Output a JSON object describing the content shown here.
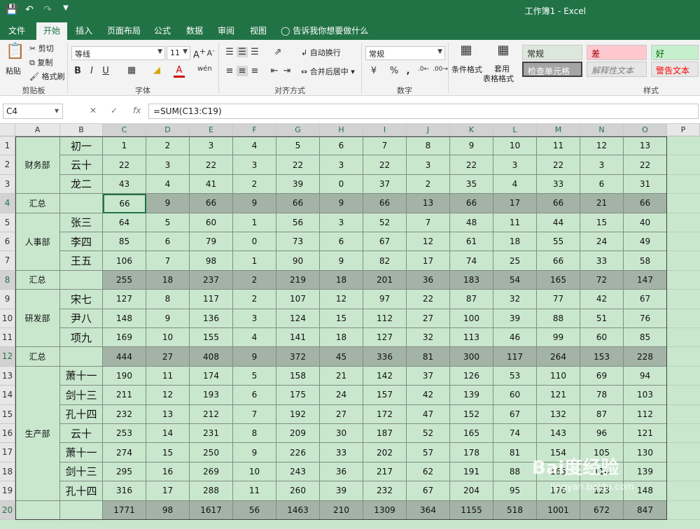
{
  "title_bar": {
    "title": "工作簿1 - Excel",
    "qat": [
      "save-icon",
      "undo-icon",
      "redo-icon",
      "customize-icon"
    ]
  },
  "tabs": [
    "文件",
    "开始",
    "插入",
    "页面布局",
    "公式",
    "数据",
    "审阅",
    "视图"
  ],
  "active_tab": "开始",
  "tell_me": "告诉我你想要做什么",
  "ribbon": {
    "clipboard": {
      "label": "剪贴板",
      "paste": "粘贴",
      "cut": "剪切",
      "copy": "复制",
      "format_painter": "格式刷"
    },
    "font": {
      "label": "字体",
      "name": "等线",
      "size": "11",
      "bold": "B",
      "italic": "I",
      "underline": "U"
    },
    "alignment": {
      "label": "对齐方式",
      "wrap": "自动换行",
      "merge": "合并后居中"
    },
    "number": {
      "label": "数字",
      "format": "常规",
      "percent": "%",
      "comma": ","
    },
    "styles_group": {
      "label": "样式",
      "cond_format": "条件格式",
      "table_format_1": "套用",
      "table_format_2": "表格格式",
      "normal": "常规",
      "bad": "差",
      "good": "好",
      "check": "检查单元格",
      "explanatory": "解释性文本",
      "warning": "警告文本"
    }
  },
  "formula_bar": {
    "name_box": "C4",
    "fx": "fx",
    "formula": "=SUM(C13:C19)"
  },
  "columns": [
    "A",
    "B",
    "C",
    "D",
    "E",
    "F",
    "G",
    "H",
    "I",
    "J",
    "K",
    "L",
    "M",
    "N",
    "O",
    "P"
  ],
  "rows": [
    {
      "n": "1",
      "dept": "财务部",
      "name": "初一",
      "vals": [
        "1",
        "2",
        "3",
        "4",
        "5",
        "6",
        "7",
        "8",
        "9",
        "10",
        "11",
        "12",
        "13"
      ]
    },
    {
      "n": "2",
      "dept": "",
      "name": "云十",
      "vals": [
        "22",
        "3",
        "22",
        "3",
        "22",
        "3",
        "22",
        "3",
        "22",
        "3",
        "22",
        "3",
        "22"
      ]
    },
    {
      "n": "3",
      "dept": "",
      "name": "龙二",
      "vals": [
        "43",
        "4",
        "41",
        "2",
        "39",
        "0",
        "37",
        "2",
        "35",
        "4",
        "33",
        "6",
        "31"
      ]
    },
    {
      "n": "4",
      "dept": "汇总",
      "name": "",
      "vals": [
        "66",
        "9",
        "66",
        "9",
        "66",
        "9",
        "66",
        "13",
        "66",
        "17",
        "66",
        "21",
        "66"
      ],
      "total": true
    },
    {
      "n": "5",
      "dept": "人事部",
      "name": "张三",
      "vals": [
        "64",
        "5",
        "60",
        "1",
        "56",
        "3",
        "52",
        "7",
        "48",
        "11",
        "44",
        "15",
        "40"
      ]
    },
    {
      "n": "6",
      "dept": "",
      "name": "李四",
      "vals": [
        "85",
        "6",
        "79",
        "0",
        "73",
        "6",
        "67",
        "12",
        "61",
        "18",
        "55",
        "24",
        "49"
      ]
    },
    {
      "n": "7",
      "dept": "",
      "name": "王五",
      "vals": [
        "106",
        "7",
        "98",
        "1",
        "90",
        "9",
        "82",
        "17",
        "74",
        "25",
        "66",
        "33",
        "58"
      ]
    },
    {
      "n": "8",
      "dept": "汇总",
      "name": "",
      "vals": [
        "255",
        "18",
        "237",
        "2",
        "219",
        "18",
        "201",
        "36",
        "183",
        "54",
        "165",
        "72",
        "147"
      ],
      "total": true
    },
    {
      "n": "9",
      "dept": "研发部",
      "name": "宋七",
      "vals": [
        "127",
        "8",
        "117",
        "2",
        "107",
        "12",
        "97",
        "22",
        "87",
        "32",
        "77",
        "42",
        "67"
      ]
    },
    {
      "n": "10",
      "dept": "",
      "name": "尹八",
      "vals": [
        "148",
        "9",
        "136",
        "3",
        "124",
        "15",
        "112",
        "27",
        "100",
        "39",
        "88",
        "51",
        "76"
      ]
    },
    {
      "n": "11",
      "dept": "",
      "name": "项九",
      "vals": [
        "169",
        "10",
        "155",
        "4",
        "141",
        "18",
        "127",
        "32",
        "113",
        "46",
        "99",
        "60",
        "85"
      ]
    },
    {
      "n": "12",
      "dept": "汇总",
      "name": "",
      "vals": [
        "444",
        "27",
        "408",
        "9",
        "372",
        "45",
        "336",
        "81",
        "300",
        "117",
        "264",
        "153",
        "228"
      ],
      "total": true
    },
    {
      "n": "13",
      "dept": "生产部",
      "name": "萧十一",
      "vals": [
        "190",
        "11",
        "174",
        "5",
        "158",
        "21",
        "142",
        "37",
        "126",
        "53",
        "110",
        "69",
        "94"
      ]
    },
    {
      "n": "14",
      "dept": "",
      "name": "剑十三",
      "vals": [
        "211",
        "12",
        "193",
        "6",
        "175",
        "24",
        "157",
        "42",
        "139",
        "60",
        "121",
        "78",
        "103"
      ]
    },
    {
      "n": "15",
      "dept": "",
      "name": "孔十四",
      "vals": [
        "232",
        "13",
        "212",
        "7",
        "192",
        "27",
        "172",
        "47",
        "152",
        "67",
        "132",
        "87",
        "112"
      ]
    },
    {
      "n": "16",
      "dept": "",
      "name": "云十",
      "vals": [
        "253",
        "14",
        "231",
        "8",
        "209",
        "30",
        "187",
        "52",
        "165",
        "74",
        "143",
        "96",
        "121"
      ]
    },
    {
      "n": "17",
      "dept": "",
      "name": "萧十一",
      "vals": [
        "274",
        "15",
        "250",
        "9",
        "226",
        "33",
        "202",
        "57",
        "178",
        "81",
        "154",
        "105",
        "130"
      ]
    },
    {
      "n": "18",
      "dept": "",
      "name": "剑十三",
      "vals": [
        "295",
        "16",
        "269",
        "10",
        "243",
        "36",
        "217",
        "62",
        "191",
        "88",
        "165",
        "114",
        "139"
      ]
    },
    {
      "n": "19",
      "dept": "",
      "name": "孔十四",
      "vals": [
        "316",
        "17",
        "288",
        "11",
        "260",
        "39",
        "232",
        "67",
        "204",
        "95",
        "176",
        "123",
        "148"
      ]
    },
    {
      "n": "20",
      "dept": "",
      "name": "",
      "vals": [
        "1771",
        "98",
        "1617",
        "56",
        "1463",
        "210",
        "1309",
        "364",
        "1155",
        "518",
        "1001",
        "672",
        "847"
      ],
      "total": true
    }
  ],
  "watermark": {
    "brand": "Bai度经验",
    "url": "jingyan.baidu.com"
  }
}
